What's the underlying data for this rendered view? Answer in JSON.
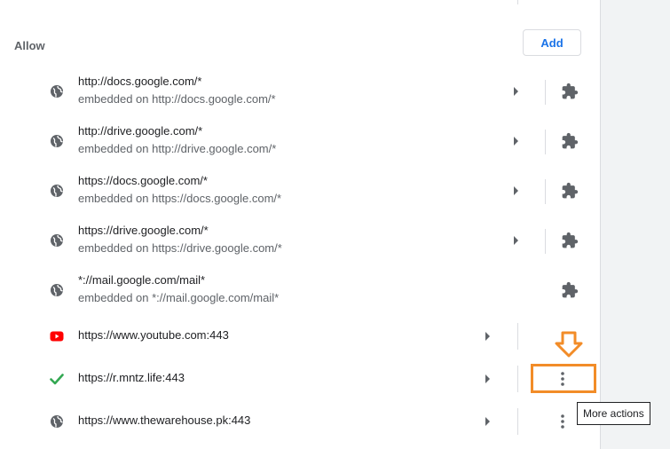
{
  "section": {
    "label": "Allow",
    "add_button": "Add"
  },
  "rows": [
    {
      "primary": "http://docs.google.com/*",
      "secondary": "embedded on http://docs.google.com/*",
      "icon": "globe-icon",
      "action_icon": "puzzle-piece-icon",
      "has_arrow": true
    },
    {
      "primary": "http://drive.google.com/*",
      "secondary": "embedded on http://drive.google.com/*",
      "icon": "globe-icon",
      "action_icon": "puzzle-piece-icon",
      "has_arrow": true
    },
    {
      "primary": "https://docs.google.com/*",
      "secondary": "embedded on https://docs.google.com/*",
      "icon": "globe-icon",
      "action_icon": "puzzle-piece-icon",
      "has_arrow": true
    },
    {
      "primary": "https://drive.google.com/*",
      "secondary": "embedded on https://drive.google.com/*",
      "icon": "globe-icon",
      "action_icon": "puzzle-piece-icon",
      "has_arrow": true
    },
    {
      "primary": "*://mail.google.com/mail*",
      "secondary": "embedded on *://mail.google.com/mail*",
      "icon": "globe-icon",
      "action_icon": "puzzle-piece-icon",
      "has_arrow": false
    },
    {
      "primary": "https://www.youtube.com:443",
      "icon": "youtube-icon",
      "action_icon": "none",
      "has_arrow": true
    },
    {
      "primary": "https://r.mntz.life:443",
      "icon": "checkmark-icon",
      "action_icon": "more-vert-icon",
      "has_arrow": true
    },
    {
      "primary": "https://www.thewarehouse.pk:443",
      "icon": "globe-icon",
      "action_icon": "more-vert-icon",
      "has_arrow": true
    }
  ],
  "tooltip": "More actions",
  "colors": {
    "accent": "#1a73e8",
    "highlight": "#f28c28",
    "youtube": "#ff0000",
    "check": "#34a853"
  }
}
